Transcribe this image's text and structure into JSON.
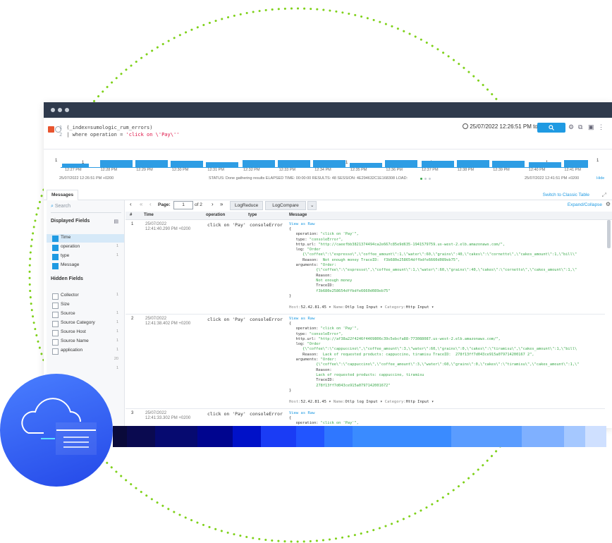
{
  "query": {
    "line1": "(_index=sumologic_rum_errors)",
    "line2_pre": "| where operation = ",
    "line2_str": "'click on \\'Pay\\''",
    "line_numbers": [
      "1",
      "2"
    ]
  },
  "toolbar": {
    "time_range": "25/07/2022 12:26:51 PM to ..."
  },
  "histogram": {
    "y_label": "1",
    "right_label": "1",
    "counts": [
      "1",
      "1",
      "1",
      "1"
    ],
    "ticks": [
      "12:27 PM",
      "12:28 PM",
      "12:29 PM",
      "12:30 PM",
      "12:31 PM",
      "12:32 PM",
      "12:33 PM",
      "12:34 PM",
      "12:35 PM",
      "12:36 PM",
      "12:37 PM",
      "12:38 PM",
      "12:39 PM",
      "12:40 PM",
      "12:41 PM"
    ],
    "start": "25/07/2022 12:26:51 PM +0200",
    "end": "25/07/2022 12:41:51 PM +0200",
    "hide": "Hide"
  },
  "status": {
    "text": "STATUS: Done gathering results   ELAPSED TIME: 00:00:00   RESULTS: 48   SESSION: 4E294632C1E168308   LOAD:"
  },
  "tabs": {
    "messages": "Messages",
    "switch": "Switch to Classic Table"
  },
  "sidebar": {
    "search_placeholder": "Search",
    "displayed_title": "Displayed Fields",
    "hidden_title": "Hidden Fields",
    "displayed": [
      {
        "label": "Time",
        "count": ""
      },
      {
        "label": "operation",
        "count": "1"
      },
      {
        "label": "type",
        "count": "1"
      },
      {
        "label": "Message",
        "count": ""
      }
    ],
    "hidden": [
      {
        "label": "Collector",
        "count": "1"
      },
      {
        "label": "Size",
        "count": ""
      },
      {
        "label": "Source",
        "count": "1"
      },
      {
        "label": "Source Category",
        "count": "1"
      },
      {
        "label": "Source Host",
        "count": "1"
      },
      {
        "label": "Source Name",
        "count": "1"
      },
      {
        "label": "application",
        "count": "1"
      },
      {
        "label": "",
        "count": "20"
      },
      {
        "label": "",
        "count": "1"
      }
    ]
  },
  "pager": {
    "page_label": "Page:",
    "page_value": "1",
    "of": "of 2",
    "logreduce": "LogReduce",
    "logcompare": "LogCompare",
    "expand": "Expand/Collapse"
  },
  "table": {
    "headers": [
      "#",
      "Time",
      "operation",
      "type",
      "Message"
    ],
    "rows": [
      {
        "num": "1",
        "date": "25/07/2022",
        "time": "12:41:40.290 PM +0200",
        "operation": "click on 'Pay'",
        "type": "consoleError",
        "view_raw": "View as Raw",
        "lines": [
          "{",
          "   operation: \"click on 'Pay'\",",
          "   type: \"consoleError\",",
          "   http.url: \"http://caeefbb3821374494ca2e667c85e9d635-1941579759.us-west-2.elb.amazonaws.com/\",",
          "   log: \"Order",
          "      {\\\"coffee\\\":\\\"espresso\\\",\\\"coffee_amount\\\":1,\\\"water\\\":60,\\\"grains\\\":40,\\\"cakes\\\":\\\"cornetto\\\",\\\"cakes_amount\\\":1,\\\"bill\\\"",
          "      Reason:  Not enough money TraceID:  f3b680e258654dffbdfe6660d089eb75\",",
          "   arguments: \"Order:",
          "            {\\\"coffee\\\":\\\"espresso\\\",\\\"coffee_amount\\\":1,\\\"water\\\":60,\\\"grains\\\":40,\\\"cakes\\\":\\\"cornetto\\\",\\\"cakes_amount\\\":1,\\\"",
          "            Reason:",
          "            Not enough money",
          "            TraceID:",
          "            f3b680e258654dffbdfe6660d089eb75\"",
          "}"
        ],
        "host": "52.42.81.45",
        "name": "Otlp log Input",
        "category": "Http Input"
      },
      {
        "num": "2",
        "date": "25/07/2022",
        "time": "12:41:38.402 PM +0200",
        "operation": "click on 'Pay'",
        "type": "consoleError",
        "view_raw": "View as Raw",
        "lines": [
          "{",
          "   operation: \"click on 'Pay'\",",
          "   type: \"consoleError\",",
          "   http.url: \"http://af38a22f4246f4469806c39c5ebcfa88-773088087.us-west-2.elb.amazonaws.com/\",",
          "   log: \"Order",
          "      {\\\"coffee\\\":\\\"cappuccino\\\",\\\"coffee_amount\\\":3,\\\"water\\\":60,\\\"grains\\\":0,\\\"cakes\\\":\\\"tiramisu\\\",\\\"cakes_amount\\\":1,\\\"bill\\",
          "      Reason:  Lack of requested products: cappuccino, tiramisu TraceID:  278f13ff7d043ce915a079714200167 2\",",
          "   arguments: \"Order:",
          "            {\\\"coffee\\\":\\\"cappuccino\\\",\\\"coffee_amount\\\":3,\\\"water\\\":60,\\\"grains\\\":0,\\\"cakes\\\":\\\"tiramisu\\\",\\\"cakes_amount\\\":1,\\\"",
          "            Reason:",
          "            Lack of requested products: cappuccino, tiramisu",
          "            TraceID:",
          "            278f13ff7d043ce915a0797142001672\"",
          "}"
        ],
        "host": "52.42.81.45",
        "name": "Otlp log Input",
        "category": "Http Input"
      },
      {
        "num": "3",
        "date": "25/07/2022",
        "time": "12:41:33.302 PM +0200",
        "operation": "click on 'Pay'",
        "type": "consoleError",
        "view_raw": "View as Raw",
        "lines": [
          "{",
          "   operation: \"click on 'Pay'\","
        ]
      }
    ],
    "meta_keys": {
      "host": "Host:",
      "name": "Name:",
      "category": "Category:"
    }
  },
  "colors": {
    "accent": "#1f9ae2",
    "titlebar": "#2f3a4c",
    "circle": "#3360f5"
  }
}
